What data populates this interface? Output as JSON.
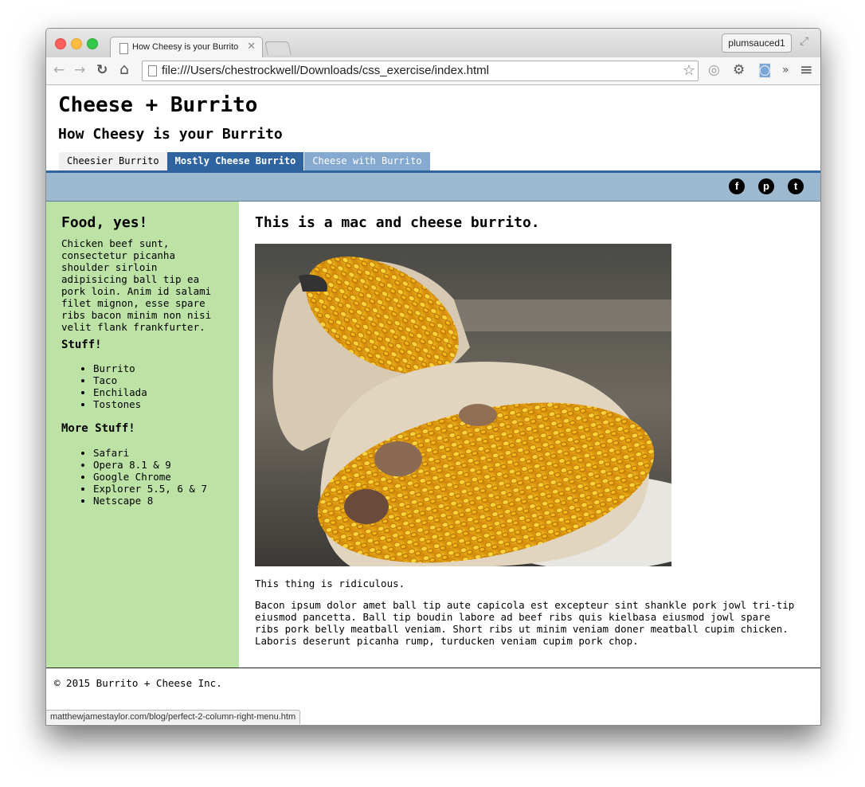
{
  "browser": {
    "tab_title": "How Cheesy is your Burrito",
    "tab_close": "✕",
    "profile_name": "plumsauced1",
    "url": "file:///Users/chestrockwell/Downloads/css_exercise/index.html",
    "status_url": "matthewjamestaylor.com/blog/perfect-2-column-right-menu.htm",
    "icons": {
      "back": "back-arrow-icon",
      "forward": "forward-arrow-icon",
      "reload": "reload-icon",
      "home": "home-icon",
      "star": "bookmark-star-icon",
      "extension": "extension-icon",
      "settings": "gear-icon",
      "camera": "camera-icon",
      "overflow": "chevron-overflow-icon",
      "menu": "hamburger-menu-icon",
      "fullscreen": "fullscreen-icon"
    },
    "glyphs": {
      "back": "←",
      "forward": "→",
      "reload": "↻",
      "home": "⌂",
      "star": "☆",
      "extension": "◎",
      "settings": "⚙",
      "camera": "◙",
      "overflow": "»",
      "menu": "≡",
      "fullscreen": "⤢"
    }
  },
  "site": {
    "title": "Cheese + Burrito",
    "subtitle": "How Cheesy is your Burrito",
    "tabs": [
      {
        "label": "Cheesier Burrito"
      },
      {
        "label": "Mostly Cheese Burrito"
      },
      {
        "label": "Cheese with Burrito"
      }
    ],
    "social": [
      {
        "name": "facebook-icon",
        "glyph": "f"
      },
      {
        "name": "pinterest-icon",
        "glyph": "p"
      },
      {
        "name": "twitter-icon",
        "glyph": "t"
      }
    ],
    "colors": {
      "nav_active": "#2f64a0",
      "nav_inactive": "#86a9cf",
      "social_bar": "#9db9cf",
      "sidebar": "#bde2a6"
    }
  },
  "sidebar": {
    "heading": "Food, yes!",
    "text": "Chicken beef sunt, consectetur picanha shoulder sirloin adipisicing ball tip ea pork loin. Anim id salami filet mignon, esse spare ribs bacon minim non nisi velit flank frankfurter.",
    "stuff_heading": "Stuff!",
    "stuff": [
      "Burrito",
      "Taco",
      "Enchilada",
      "Tostones"
    ],
    "more_heading": "More Stuff!",
    "more": [
      "Safari",
      "Opera 8.1 & 9",
      "Google Chrome",
      "Explorer 5.5, 6 & 7",
      "Netscape 8"
    ]
  },
  "main": {
    "heading": "This is a mac and cheese burrito.",
    "caption": "This thing is ridiculous.",
    "paragraph": "Bacon ipsum dolor amet ball tip aute capicola est excepteur sint shankle pork jowl tri-tip eiusmod pancetta. Ball tip boudin labore ad beef ribs quis kielbasa eiusmod jowl spare ribs pork belly meatball veniam. Short ribs ut minim veniam doner meatball cupim chicken. Laboris deserunt picanha rump, turducken veniam cupim pork chop."
  },
  "footer": {
    "text": "© 2015 Burrito + Cheese Inc."
  }
}
